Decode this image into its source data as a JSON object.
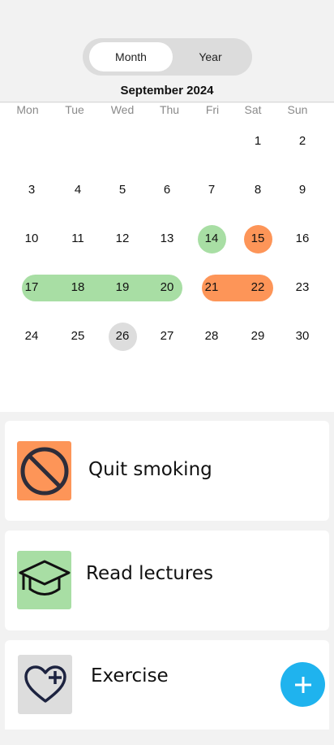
{
  "view_toggle": {
    "month_label": "Month",
    "year_label": "Year",
    "selected": "Month"
  },
  "calendar": {
    "title": "September 2024",
    "weekdays": [
      "Mon",
      "Tue",
      "Wed",
      "Thu",
      "Fri",
      "Sat",
      "Sun"
    ],
    "first_weekday_index": 5,
    "days_in_month": 30,
    "today": 26,
    "highlights": [
      {
        "day": 14,
        "color": "#a8dea4"
      },
      {
        "day": 15,
        "color": "#fd9558"
      }
    ],
    "ranges": [
      {
        "start": 17,
        "end": 20,
        "color": "#a8dea4"
      },
      {
        "start": 21,
        "end": 22,
        "color": "#fd9558"
      }
    ]
  },
  "habits": [
    {
      "label": "Quit smoking",
      "icon": "no-symbol-icon",
      "color": "#fd9558"
    },
    {
      "label": "Read lectures",
      "icon": "graduation-cap-icon",
      "color": "#a8dea4"
    },
    {
      "label": "Exercise",
      "icon": "heart-plus-icon",
      "color": "#dddddd"
    }
  ],
  "fab": {
    "label": "+",
    "color": "#1fb3ee"
  }
}
